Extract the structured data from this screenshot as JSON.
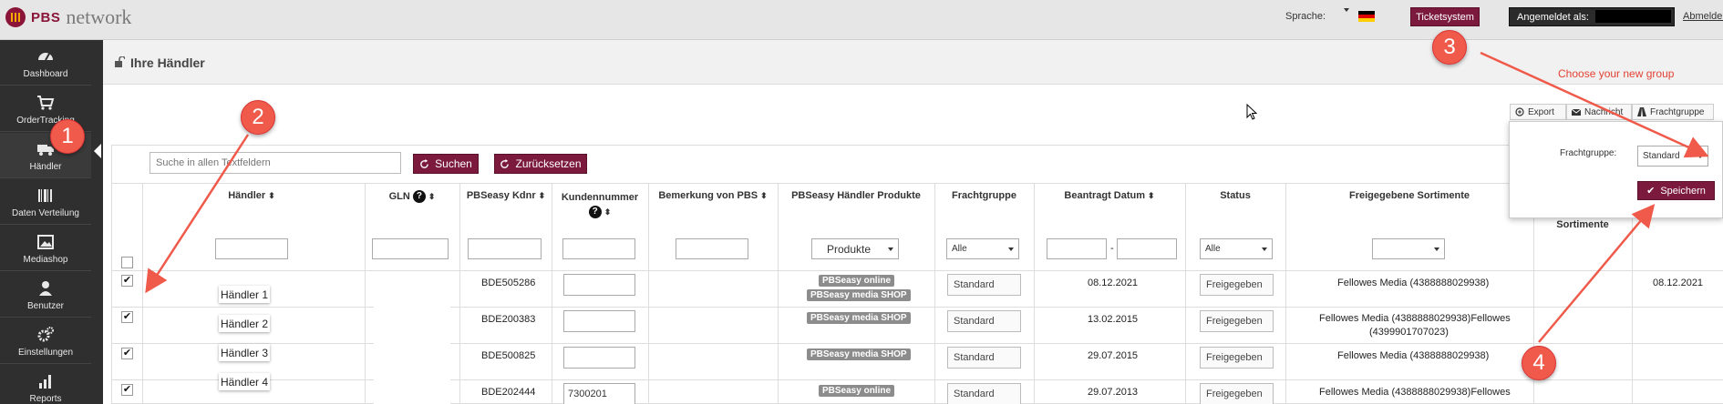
{
  "header": {
    "logo_pbs": "PBS",
    "logo_network": "network",
    "language_label": "Sprache:",
    "ticket_button": "Ticketsystem",
    "logged_in_label": "Angemeldet als:",
    "logout": "Abmelden"
  },
  "sidebar": {
    "items": [
      {
        "label": "Dashboard",
        "icon": "dashboard-icon"
      },
      {
        "label": "OrderTracking",
        "icon": "cart-icon"
      },
      {
        "label": "Händler",
        "icon": "truck-icon"
      },
      {
        "label": "Daten Verteilung",
        "icon": "barcode-icon"
      },
      {
        "label": "Mediashop",
        "icon": "image-icon"
      },
      {
        "label": "Benutzer",
        "icon": "user-icon"
      },
      {
        "label": "Einstellungen",
        "icon": "gears-icon"
      },
      {
        "label": "Reports",
        "icon": "bar-chart-icon"
      }
    ]
  },
  "page": {
    "title": "Ihre Händler"
  },
  "toolbar": {
    "export": "Export",
    "nachricht": "Nachricht",
    "frachtgruppe": "Frachtgruppe"
  },
  "search": {
    "placeholder": "Suche in allen Textfeldern",
    "search_button": "Suchen",
    "reset_button": "Zurücksetzen"
  },
  "table": {
    "columns": {
      "haendler": "Händler",
      "gln": "GLN",
      "kdnr": "PBSeasy Kdnr",
      "kundennummer": "Kundennummer",
      "bemerkung": "Bemerkung von PBS",
      "produkte": "PBSeasy Händler Produkte",
      "frachtgruppe": "Frachtgruppe",
      "beantragt": "Beantragt Datum",
      "status": "Status",
      "sortimente": "Freigegebene Sortimente",
      "sortimente_extra": "Sortimente"
    },
    "filters": {
      "produkte": "Produkte",
      "frachtgruppe": "Alle",
      "date_separator": "-",
      "status": "Alle"
    },
    "rows": [
      {
        "name": "Händler 1",
        "kdnr": "BDE505286",
        "kundennummer": "",
        "products": [
          "PBSeasy online",
          "PBSeasy media SHOP"
        ],
        "frachtgruppe": "Standard",
        "date": "08.12.2021",
        "status": "Freigegeben",
        "sortimente": "Fellowes Media (4388888029938)",
        "extra_date": "08.12.2021"
      },
      {
        "name": "Händler 2",
        "kdnr": "BDE200383",
        "kundennummer": "",
        "products": [
          "PBSeasy media SHOP"
        ],
        "frachtgruppe": "Standard",
        "date": "13.02.2015",
        "status": "Freigegeben",
        "sortimente_line1": "Fellowes Media (4388888029938)Fellowes",
        "sortimente_line2": "(4399901707023)"
      },
      {
        "name": "Händler 3",
        "kdnr": "BDE500825",
        "kundennummer": "",
        "products": [
          "PBSeasy media SHOP"
        ],
        "frachtgruppe": "Standard",
        "date": "29.07.2015",
        "status": "Freigegeben",
        "sortimente": "Fellowes Media (4388888029938)"
      },
      {
        "name": "Händler 4",
        "kdnr": "BDE202444",
        "kundennummer": "7300201",
        "products": [
          "PBSeasy online"
        ],
        "frachtgruppe": "Standard",
        "date": "29.07.2013",
        "status": "Freigegeben",
        "sortimente": "Fellowes Media (4388888029938)Fellowes"
      }
    ]
  },
  "popover": {
    "label": "Frachtgruppe:",
    "selected": "Standard",
    "save": "Speichern"
  },
  "annotations": {
    "badges": [
      "1",
      "2",
      "3",
      "4"
    ],
    "hint": "Choose your new group",
    "color": "#ef5a4a"
  },
  "colors": {
    "brand": "#7b1a3c",
    "sidebar": "#2f2f2f",
    "pill": "#8c8c8c"
  }
}
